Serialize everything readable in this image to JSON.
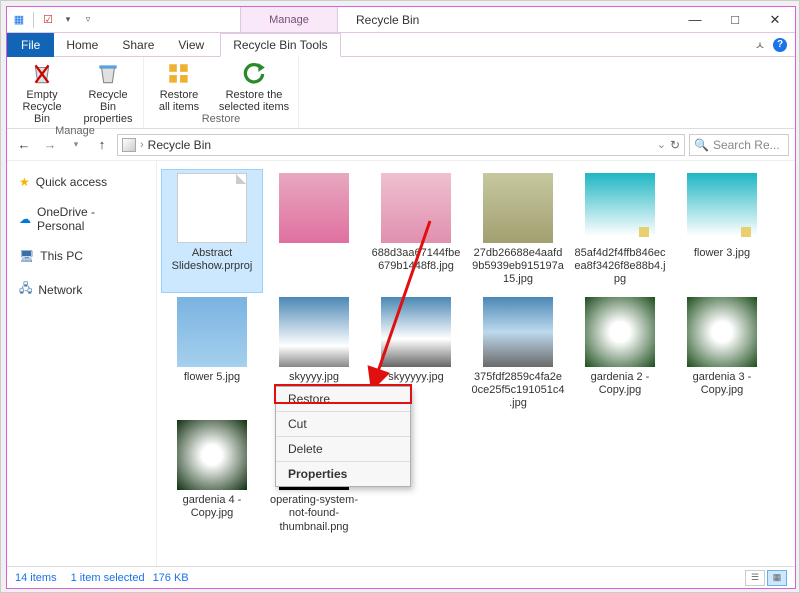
{
  "titlebar": {
    "manage_label": "Manage",
    "window_title": "Recycle Bin"
  },
  "tabs": {
    "file": "File",
    "home": "Home",
    "share": "Share",
    "view": "View",
    "rbtools": "Recycle Bin Tools"
  },
  "ribbon": {
    "group_manage": "Manage",
    "group_restore": "Restore",
    "empty_bin_l1": "Empty",
    "empty_bin_l2": "Recycle Bin",
    "bin_props_l1": "Recycle Bin",
    "bin_props_l2": "properties",
    "restore_all_l1": "Restore",
    "restore_all_l2": "all items",
    "restore_sel_l1": "Restore the",
    "restore_sel_l2": "selected items"
  },
  "address": {
    "location": "Recycle Bin"
  },
  "search": {
    "placeholder": "Search Re..."
  },
  "sidebar": {
    "quick_access": "Quick access",
    "onedrive": "OneDrive - Personal",
    "this_pc": "This PC",
    "network": "Network"
  },
  "files": [
    {
      "name": "Abstract Slideshow.prproj",
      "thumb": "page",
      "selected": true
    },
    {
      "name": "",
      "thumb": "flower1"
    },
    {
      "name": "688d3aa67144fbe679b1448f8.jpg",
      "thumb": "flower2"
    },
    {
      "name": "27db26688e4aafd9b5939eb915197a15.jpg",
      "thumb": "flower3"
    },
    {
      "name": "85af4d2f4ffb846ecea8f3426f8e88b4.jpg",
      "thumb": "teal"
    },
    {
      "name": "flower 3.jpg",
      "thumb": "teal"
    },
    {
      "name": "flower 5.jpg",
      "thumb": "sky1"
    },
    {
      "name": "skyyyy.jpg",
      "thumb": "sky3"
    },
    {
      "name": "skyyyyy.jpg",
      "thumb": "sky4"
    },
    {
      "name": "375fdf2859c4fa2e0ce25f5c191051c4.jpg",
      "thumb": "sky5"
    },
    {
      "name": "gardenia 2 - Copy.jpg",
      "thumb": "gard1"
    },
    {
      "name": "gardenia 3 - Copy.jpg",
      "thumb": "gard1"
    },
    {
      "name": "gardenia 4 - Copy.jpg",
      "thumb": "gard2"
    },
    {
      "name": "operating-system-not-found-thumbnail.png",
      "thumb": "black"
    }
  ],
  "context_menu": {
    "restore": "Restore",
    "cut": "Cut",
    "delete": "Delete",
    "properties": "Properties"
  },
  "status": {
    "items": "14 items",
    "selected": "1 item selected",
    "size": "176 KB"
  }
}
